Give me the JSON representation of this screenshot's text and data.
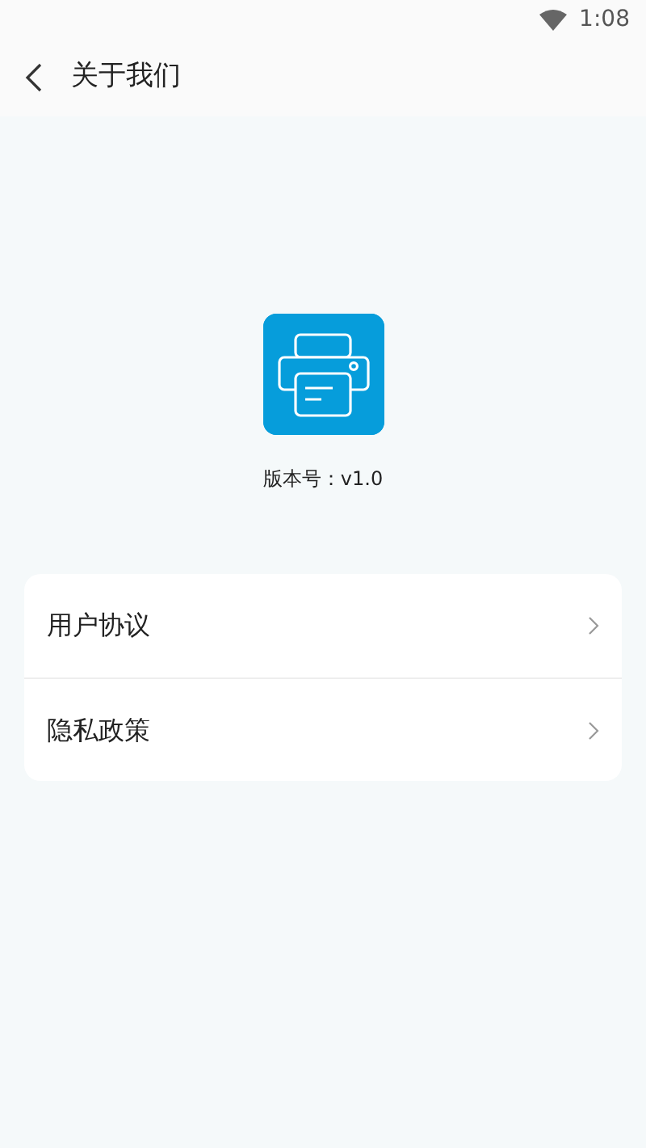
{
  "status_bar": {
    "time": "1:08"
  },
  "header": {
    "title": "关于我们"
  },
  "app": {
    "version": "版本号：v1.0"
  },
  "menu": [
    {
      "label": "用户协议"
    },
    {
      "label": "隐私政策"
    }
  ]
}
